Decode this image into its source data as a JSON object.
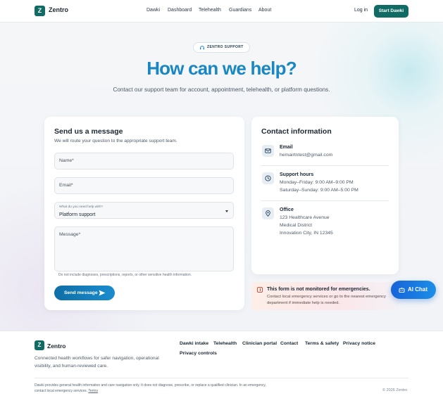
{
  "brand": {
    "logo_letter": "Z",
    "name": "Zentro"
  },
  "nav": {
    "items": [
      "Dawki",
      "Dashboard",
      "Telehealth",
      "Guardians",
      "About"
    ]
  },
  "header_actions": {
    "login": "Log in",
    "start": "Start Dawki"
  },
  "hero": {
    "badge": "ZENTRO SUPPORT",
    "title": "How can we help?",
    "subtitle": "Contact our support team for account, appointment, telehealth, or platform questions."
  },
  "form": {
    "title": "Send us a message",
    "subtitle": "We will route your question to the appropriate support team.",
    "name_label": "Name",
    "email_label": "Email",
    "topic_label": "What do you need help with?",
    "topic_value": "Platform support",
    "message_label": "Message",
    "required_mark": "*",
    "note": "Do not include diagnoses, prescriptions, reports, or other sensitive health information.",
    "send_label": "Send message"
  },
  "contact": {
    "title": "Contact information",
    "email": {
      "title": "Email",
      "value": "hemairtntest@gmail.com"
    },
    "hours": {
      "title": "Support hours",
      "weekday": "Monday–Friday: 9:00 AM–9:00 PM",
      "weekend": "Saturday–Sunday: 9:00 AM–5:00 PM"
    },
    "office": {
      "title": "Office",
      "line1": "123 Healthcare Avenue",
      "line2": "Medical District",
      "line3": "Innovation City, IN 12345"
    }
  },
  "emergency": {
    "title": "This form is not monitored for emergencies.",
    "text": "Contact local emergency services or go to the nearest emergency department if immediate help is needed."
  },
  "ai_chat": {
    "label": "AI Chat"
  },
  "footer": {
    "tagline": "Connected health workflows for safer navigation, operational visibility, and human-reviewed care.",
    "links": [
      "Dawki intake",
      "Telehealth",
      "Clinician portal",
      "Contact",
      "Terms & safety",
      "Privacy notice",
      "Privacy controls"
    ],
    "disclaimer": "Dawki provides general health information and care navigation only. It does not diagnose, prescribe, or replace a qualified clinician. In an emergency, contact local emergency services.",
    "terms_link": "Terms",
    "copyright": "© 2026 Zentro"
  },
  "colors": {
    "brand": "#0f6b63",
    "accent": "#1a87c2",
    "ai_chat": "#1563d8",
    "emergency": "#d1503d"
  },
  "icons": [
    "mail-icon",
    "clock-icon",
    "map-pin-icon",
    "send-icon",
    "robot-icon",
    "alert-icon",
    "headset-icon",
    "chevron-down-icon"
  ]
}
